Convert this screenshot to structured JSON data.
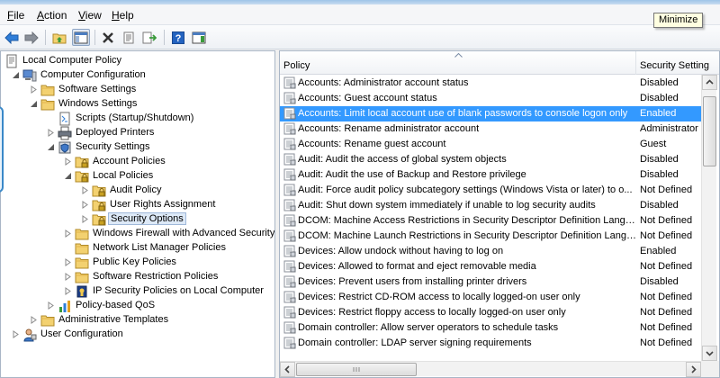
{
  "menu": [
    {
      "mnemonic": "F",
      "rest": "ile"
    },
    {
      "mnemonic": "A",
      "rest": "ction"
    },
    {
      "mnemonic": "V",
      "rest": "iew"
    },
    {
      "mnemonic": "H",
      "rest": "elp"
    }
  ],
  "toolbar": {
    "buttons": [
      "back-arrow-icon",
      "forward-arrow-icon",
      "up-folder-icon",
      "show-hide-tree-icon",
      "delete-icon",
      "properties-icon",
      "export-list-icon",
      "help-icon",
      "show-action-pane-icon"
    ]
  },
  "tooltip": {
    "text": "Minimize"
  },
  "tree": [
    {
      "label": "Local Computer Policy",
      "depth": 0,
      "expander": "none",
      "icon": "policy-document-icon"
    },
    {
      "label": "Computer Configuration",
      "depth": 1,
      "expander": "expanded",
      "icon": "computer-icon"
    },
    {
      "label": "Software Settings",
      "depth": 2,
      "expander": "collapsed",
      "icon": "folder-icon"
    },
    {
      "label": "Windows Settings",
      "depth": 2,
      "expander": "expanded",
      "icon": "folder-icon"
    },
    {
      "label": "Scripts (Startup/Shutdown)",
      "depth": 3,
      "expander": "none",
      "icon": "scripts-icon"
    },
    {
      "label": "Deployed Printers",
      "depth": 3,
      "expander": "collapsed",
      "icon": "printer-icon"
    },
    {
      "label": "Security Settings",
      "depth": 3,
      "expander": "expanded",
      "icon": "security-settings-icon"
    },
    {
      "label": "Account Policies",
      "depth": 4,
      "expander": "collapsed",
      "icon": "locked-folder-icon"
    },
    {
      "label": "Local Policies",
      "depth": 4,
      "expander": "expanded",
      "icon": "locked-folder-icon"
    },
    {
      "label": "Audit Policy",
      "depth": 5,
      "expander": "collapsed",
      "icon": "locked-folder-icon"
    },
    {
      "label": "User Rights Assignment",
      "depth": 5,
      "expander": "collapsed",
      "icon": "locked-folder-icon"
    },
    {
      "label": "Security Options",
      "depth": 5,
      "expander": "collapsed",
      "icon": "locked-folder-icon",
      "selected": true
    },
    {
      "label": "Windows Firewall with Advanced Security",
      "depth": 4,
      "expander": "collapsed",
      "icon": "folder-icon"
    },
    {
      "label": "Network List Manager Policies",
      "depth": 4,
      "expander": "none",
      "icon": "folder-icon"
    },
    {
      "label": "Public Key Policies",
      "depth": 4,
      "expander": "collapsed",
      "icon": "folder-icon"
    },
    {
      "label": "Software Restriction Policies",
      "depth": 4,
      "expander": "collapsed",
      "icon": "folder-icon"
    },
    {
      "label": "IP Security Policies on Local Computer",
      "depth": 4,
      "expander": "collapsed",
      "icon": "ip-security-icon"
    },
    {
      "label": "Policy-based QoS",
      "depth": 3,
      "expander": "collapsed",
      "icon": "qos-chart-icon"
    },
    {
      "label": "Administrative Templates",
      "depth": 2,
      "expander": "collapsed",
      "icon": "folder-icon"
    },
    {
      "label": "User Configuration",
      "depth": 1,
      "expander": "collapsed",
      "icon": "user-icon"
    }
  ],
  "list": {
    "columns": {
      "policy": "Policy",
      "setting": "Security Setting"
    },
    "rows": [
      {
        "policy": "Accounts: Administrator account status",
        "setting": "Disabled"
      },
      {
        "policy": "Accounts: Guest account status",
        "setting": "Disabled"
      },
      {
        "policy": "Accounts: Limit local account use of blank passwords to console logon only",
        "setting": "Enabled",
        "selected": true
      },
      {
        "policy": "Accounts: Rename administrator account",
        "setting": "Administrator"
      },
      {
        "policy": "Accounts: Rename guest account",
        "setting": "Guest"
      },
      {
        "policy": "Audit: Audit the access of global system objects",
        "setting": "Disabled"
      },
      {
        "policy": "Audit: Audit the use of Backup and Restore privilege",
        "setting": "Disabled"
      },
      {
        "policy": "Audit: Force audit policy subcategory settings (Windows Vista or later) to o...",
        "setting": "Not Defined"
      },
      {
        "policy": "Audit: Shut down system immediately if unable to log security audits",
        "setting": "Disabled"
      },
      {
        "policy": "DCOM: Machine Access Restrictions in Security Descriptor Definition Langu...",
        "setting": "Not Defined"
      },
      {
        "policy": "DCOM: Machine Launch Restrictions in Security Descriptor Definition Langu...",
        "setting": "Not Defined"
      },
      {
        "policy": "Devices: Allow undock without having to log on",
        "setting": "Enabled"
      },
      {
        "policy": "Devices: Allowed to format and eject removable media",
        "setting": "Not Defined"
      },
      {
        "policy": "Devices: Prevent users from installing printer drivers",
        "setting": "Disabled"
      },
      {
        "policy": "Devices: Restrict CD-ROM access to locally logged-on user only",
        "setting": "Not Defined"
      },
      {
        "policy": "Devices: Restrict floppy access to locally logged-on user only",
        "setting": "Not Defined"
      },
      {
        "policy": "Domain controller: Allow server operators to schedule tasks",
        "setting": "Not Defined"
      },
      {
        "policy": "Domain controller: LDAP server signing requirements",
        "setting": "Not Defined"
      }
    ]
  },
  "colors": {
    "selection": "#3399ff",
    "tree_selection": "#dde9f7",
    "folder": "#f3d170"
  }
}
